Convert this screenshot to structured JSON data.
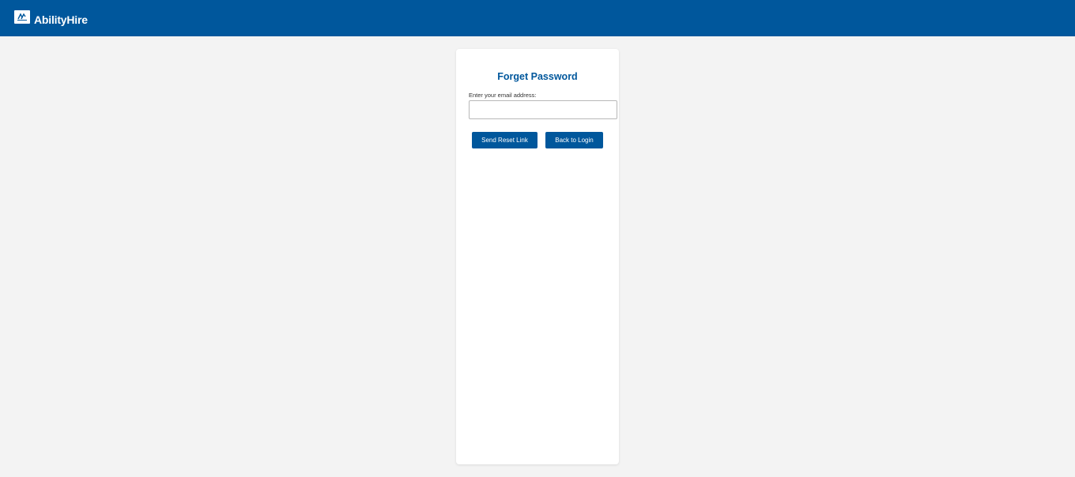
{
  "header": {
    "brand_name": "AbilityHire",
    "logo_icon": "ability-logo-icon",
    "background_color": "#00579c"
  },
  "form": {
    "title": "Forget Password",
    "email_label": "Enter your email address:",
    "email_value": "",
    "email_placeholder": "",
    "send_button_label": "Send Reset Link",
    "back_button_label": "Back to Login",
    "accent_color": "#00579c"
  }
}
